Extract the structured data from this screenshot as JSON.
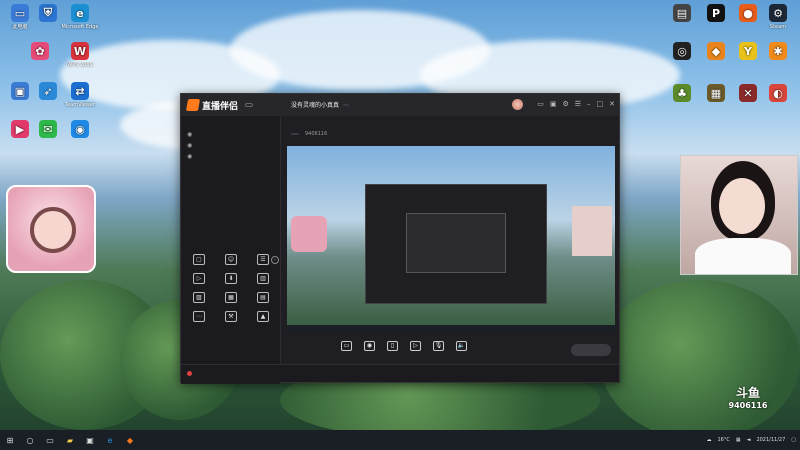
{
  "desktop_left": [
    {
      "label": "此电脑",
      "icon": "computer-icon",
      "color": "#3b7bd8",
      "glyph": "▭"
    },
    {
      "label": "",
      "icon": "shield-icon",
      "color": "#2b74d1",
      "glyph": "⛨"
    },
    {
      "label": "Microsoft Edge",
      "icon": "edge-icon",
      "color": "#1b8fd1",
      "glyph": "e"
    },
    {
      "label": "",
      "icon": "colorful-app-icon",
      "color": "#e64a76",
      "glyph": "✿"
    },
    {
      "label": "WPS 2019",
      "icon": "wps-icon",
      "color": "#d9323c",
      "glyph": "W"
    },
    {
      "label": "",
      "icon": "app-icon",
      "color": "#3a7bd5",
      "glyph": "▣"
    },
    {
      "label": "",
      "icon": "feather-icon",
      "color": "#2a88d8",
      "glyph": "➶"
    },
    {
      "label": "TeamViewer",
      "icon": "teamviewer-icon",
      "color": "#1b6fd1",
      "glyph": "⇄"
    },
    {
      "label": "",
      "icon": "video-app-icon",
      "color": "#e03a6a",
      "glyph": "▶"
    },
    {
      "label": "",
      "icon": "wechat-icon",
      "color": "#2eb84a",
      "glyph": "✉"
    },
    {
      "label": "",
      "icon": "browser-icon",
      "color": "#1e88e5",
      "glyph": "◉"
    }
  ],
  "desktop_right": [
    {
      "label": "",
      "icon": "app-icon",
      "color": "#444",
      "glyph": "▤"
    },
    {
      "label": "",
      "icon": "black-app-icon",
      "color": "#111",
      "glyph": "P"
    },
    {
      "label": "",
      "icon": "orange-app-icon",
      "color": "#e85c1a",
      "glyph": "●"
    },
    {
      "label": "Steam",
      "icon": "steam-icon",
      "color": "#1b2838",
      "glyph": "⚙"
    },
    {
      "label": "",
      "icon": "obs-icon",
      "color": "#222",
      "glyph": "◎"
    },
    {
      "label": "",
      "icon": "game-icon",
      "color": "#e8841a",
      "glyph": "◆"
    },
    {
      "label": "",
      "icon": "yy-icon",
      "color": "#e8c21a",
      "glyph": "Y"
    },
    {
      "label": "",
      "icon": "orange-app-icon",
      "color": "#f08a1a",
      "glyph": "✱"
    },
    {
      "label": "",
      "icon": "game-icon",
      "color": "#5a8a2a",
      "glyph": "♣"
    },
    {
      "label": "",
      "icon": "game-icon",
      "color": "#6a5a2a",
      "glyph": "▦"
    },
    {
      "label": "",
      "icon": "game-icon",
      "color": "#8a2a2a",
      "glyph": "✕"
    },
    {
      "label": "",
      "icon": "chrome-icon",
      "color": "#d9453a",
      "glyph": "◐"
    }
  ],
  "app": {
    "name": "直播伴侣",
    "version_badge": "",
    "room_title": "没有灵魂的小真真",
    "room_tag": "",
    "category": "",
    "room_id": "9406116",
    "followers": "",
    "tabs": [
      "",
      "",
      ""
    ],
    "scenes": [
      "",
      "",
      ""
    ],
    "tools_heading": "",
    "tools": [
      {
        "label": "",
        "icon": "comment-icon",
        "glyph": "▢"
      },
      {
        "label": "",
        "icon": "assistant-icon",
        "glyph": "☺"
      },
      {
        "label": "",
        "icon": "task-icon",
        "glyph": "☰"
      },
      {
        "label": "",
        "icon": "video-icon",
        "glyph": "▷"
      },
      {
        "label": "",
        "icon": "download-icon",
        "glyph": "⬇"
      },
      {
        "label": "",
        "icon": "stats-icon",
        "glyph": "▥"
      },
      {
        "label": "",
        "icon": "gift-icon",
        "glyph": "▨"
      },
      {
        "label": "",
        "icon": "calendar-icon",
        "glyph": "▦"
      },
      {
        "label": "",
        "icon": "data-icon",
        "glyph": "▤"
      },
      {
        "label": "",
        "icon": "more-icon",
        "glyph": "⋯"
      },
      {
        "label": "",
        "icon": "tool-icon",
        "glyph": "⚒"
      },
      {
        "label": "",
        "icon": "tool-icon",
        "glyph": "▲"
      }
    ],
    "bottom_tools": [
      {
        "label": "",
        "icon": "screen-capture-icon",
        "glyph": "▭"
      },
      {
        "label": "",
        "icon": "camera-icon",
        "glyph": "◉"
      },
      {
        "label": "",
        "icon": "phone-capture-icon",
        "glyph": "▯"
      },
      {
        "label": "",
        "icon": "media-icon",
        "glyph": "▷"
      },
      {
        "label": "",
        "icon": "microphone-icon",
        "glyph": "🎙"
      },
      {
        "label": "",
        "icon": "speaker-icon",
        "glyph": "🔈"
      }
    ],
    "start_label": "",
    "status_text": "",
    "status_metrics": [
      "",
      "",
      "",
      ""
    ]
  },
  "stickers": {
    "lines": [
      "",
      "",
      "",
      "",
      ""
    ]
  },
  "watermark": {
    "brand": "斗鱼",
    "sub": "",
    "room_number": "9406116"
  },
  "taskbar": {
    "weather": "16°C",
    "time": "",
    "date": "2021/11/27"
  }
}
